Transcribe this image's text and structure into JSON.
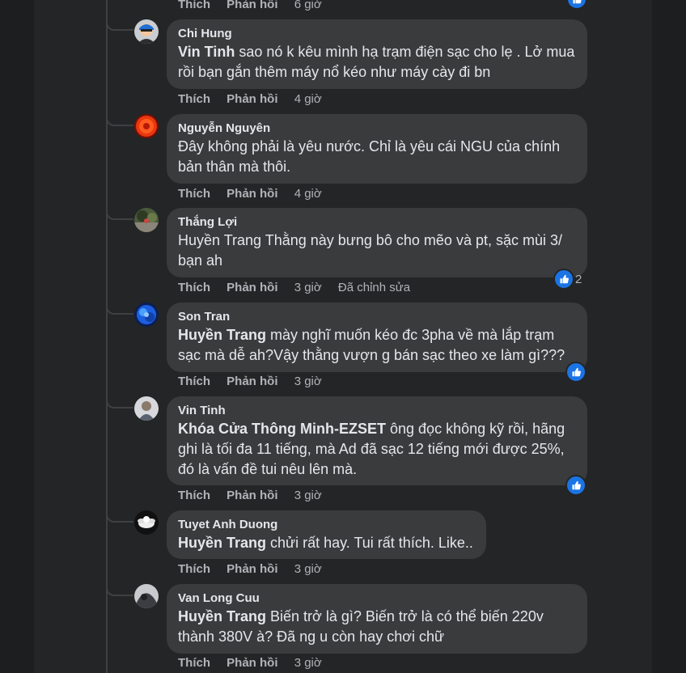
{
  "top_actions": {
    "like": "Thích",
    "reply": "Phản hồi",
    "time": "6 giờ"
  },
  "comments": [
    {
      "author": "Chi Hung",
      "mention": "Vin Tinh",
      "text": " sao nó k kêu mình hạ trạm điện sạc cho lẹ . Lở mua rồi bạn gắn thêm máy nổ kéo như máy cày đi bn",
      "like": "Thích",
      "reply": "Phản hồi",
      "time": "4 giờ"
    },
    {
      "author": "Nguyễn Nguyên",
      "mention": "",
      "text": "Đây không phải là yêu nước. Chỉ là yêu cái NGU của chính bản thân mà thôi.",
      "like": "Thích",
      "reply": "Phản hồi",
      "time": "4 giờ"
    },
    {
      "author": "Thắng Lợi",
      "mention": "",
      "text": "Huyền Trang Thằng này bưng bô cho mẽo và pt, sặc mùi 3/ bạn ah",
      "like": "Thích",
      "reply": "Phản hồi",
      "time": "3 giờ",
      "edited": "Đã chỉnh sửa",
      "reaction_count": "2"
    },
    {
      "author": "Son Tran",
      "mention": "Huyền Trang",
      "text": " mày nghĩ muốn kéo đc 3pha về mà lắp trạm sạc mà dễ ah?Vậy thằng vượn g bán sạc theo xe làm gì???",
      "like": "Thích",
      "reply": "Phản hồi",
      "time": "3 giờ"
    },
    {
      "author": "Vin Tinh",
      "mention": "Khóa Cửa Thông Minh-EZSET",
      "text": " ông đọc không kỹ rồi, hãng ghi là tối đa 11 tiếng, mà Ad đã sạc 12 tiếng mới được 25%, đó là vấn đề tui nêu lên mà.",
      "like": "Thích",
      "reply": "Phản hồi",
      "time": "3 giờ"
    },
    {
      "author": "Tuyet Anh Duong",
      "mention": "Huyền Trang",
      "text": " chửi rất hay. Tui rất thích. Like..",
      "like": "Thích",
      "reply": "Phản hồi",
      "time": "3 giờ"
    },
    {
      "author": "Van Long Cuu",
      "mention": "Huyền Trang",
      "text": " Biến trở là gì? Biến trở là có thể biến 220v thành 380V à? Đã ng u còn hay chơi chữ",
      "like": "Thích",
      "reply": "Phản hồi",
      "time": "3 giờ"
    }
  ],
  "colors": {
    "background": "#1c1e1f",
    "panel": "#242526",
    "bubble": "#3a3b3c",
    "like_blue": "#1b74e4",
    "text": "#e4e6eb",
    "muted": "#b0b3b8"
  }
}
